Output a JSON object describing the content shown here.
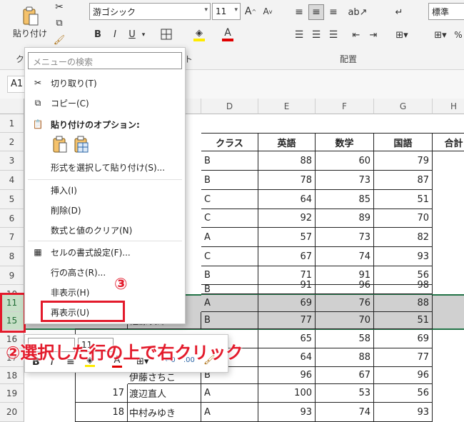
{
  "ribbon": {
    "paste_label": "貼り付け",
    "font_name": "游ゴシック",
    "font_size": "11",
    "number_format": "標準",
    "font_size_increase": "A",
    "font_size_decrease": "A",
    "bold": "B",
    "italic": "I",
    "underline": "U",
    "font_color_letter": "A",
    "group_alignment": "配置",
    "group_clipboard_initial": "ク",
    "group_font_end": "ト",
    "accent_color": "#217346"
  },
  "namebox": {
    "value": "A1"
  },
  "columns": [
    "D",
    "E",
    "F",
    "G",
    "H"
  ],
  "rows": [
    {
      "num": "1"
    },
    {
      "num": "2",
      "d": "クラス",
      "e": "英語",
      "f": "数学",
      "g": "国語",
      "h": "合計"
    },
    {
      "num": "3",
      "d": "B",
      "e": "88",
      "f": "60",
      "g": "79"
    },
    {
      "num": "4",
      "d": "B",
      "e": "78",
      "f": "73",
      "g": "87"
    },
    {
      "num": "5",
      "d": "C",
      "e": "64",
      "f": "85",
      "g": "51"
    },
    {
      "num": "6",
      "d": "C",
      "e": "92",
      "f": "89",
      "g": "70"
    },
    {
      "num": "7",
      "d": "A",
      "e": "57",
      "f": "73",
      "g": "82"
    },
    {
      "num": "8",
      "d": "C",
      "e": "67",
      "f": "74",
      "g": "93"
    },
    {
      "num": "9",
      "d": "B",
      "e": "71",
      "f": "91",
      "g": "56"
    },
    {
      "num": "10",
      "d": "B",
      "e": "91",
      "f": "96",
      "g": "98"
    },
    {
      "num": "11",
      "d": "A",
      "e": "69",
      "f": "76",
      "g": "88"
    },
    {
      "num": "15",
      "b_partial": "13",
      "c_partial": "佐藤次郎",
      "d": "B",
      "e": "77",
      "f": "70",
      "g": "51"
    },
    {
      "num": "16",
      "d": "",
      "e": "65",
      "f": "58",
      "g": "69"
    },
    {
      "num": "17",
      "d": "",
      "e": "64",
      "f": "88",
      "g": "77"
    },
    {
      "num": "18",
      "c_partial": "伊藤さちこ",
      "d": "B",
      "e": "96",
      "f": "67",
      "g": "96"
    },
    {
      "num": "19",
      "b": "17",
      "c": "渡辺直人",
      "d": "A",
      "e": "100",
      "f": "53",
      "g": "56"
    },
    {
      "num": "20",
      "b": "18",
      "c": "中村みゆき",
      "d": "A",
      "e": "93",
      "f": "74",
      "g": "93"
    }
  ],
  "context_menu": {
    "search_placeholder": "メニューの検索",
    "cut": "切り取り(T)",
    "copy": "コピー(C)",
    "paste_options": "貼り付けのオプション:",
    "paste_special": "形式を選択して貼り付け(S)...",
    "insert": "挿入(I)",
    "delete": "削除(D)",
    "clear": "数式と値のクリア(N)",
    "format_cells": "セルの書式設定(F)...",
    "row_height": "行の高さ(R)...",
    "hide": "非表示(H)",
    "unhide": "再表示(U)"
  },
  "mini_toolbar": {
    "font_size": "11",
    "bold": "B",
    "italic": "I",
    "font_color_letter": "A"
  },
  "annotations": {
    "step3": "③",
    "step2": "②選択した行の上で右クリック",
    "color": "#e31a2b"
  }
}
